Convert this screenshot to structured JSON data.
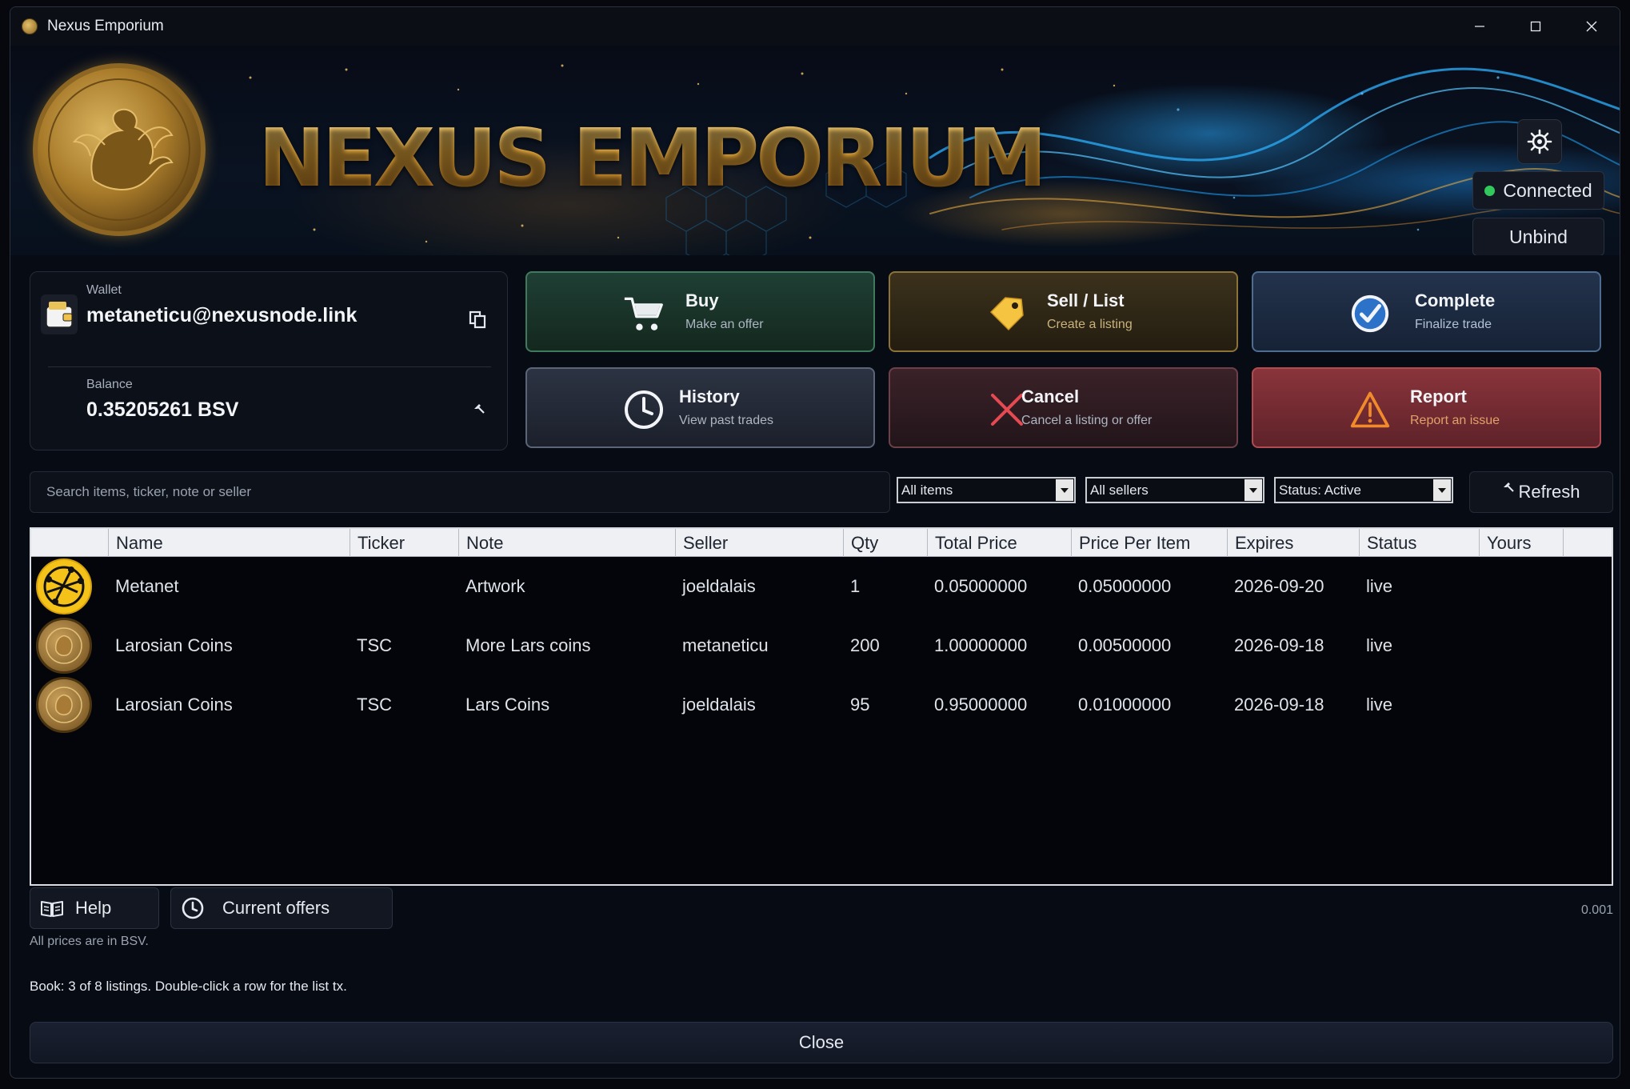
{
  "window": {
    "title": "Nexus Emporium"
  },
  "banner": {
    "title": "NEXUS EMPORIUM",
    "medallion_text": "NEXUS EMPORIUM"
  },
  "connection": {
    "status": "Connected",
    "status_color": "#31c95b",
    "unbind_label": "Unbind"
  },
  "wallet": {
    "wallet_label": "Wallet",
    "address": "metaneticu@nexusnode.link",
    "balance_label": "Balance",
    "balance": "0.35205261 BSV"
  },
  "actions": [
    {
      "title": "Buy",
      "subtitle": "Make an offer",
      "icon": "cart-icon"
    },
    {
      "title": "Sell / List",
      "subtitle": "Create a listing",
      "icon": "tag-icon"
    },
    {
      "title": "Complete",
      "subtitle": "Finalize trade",
      "icon": "check-circle-icon"
    },
    {
      "title": "History",
      "subtitle": "View past trades",
      "icon": "clock-icon"
    },
    {
      "title": "Cancel",
      "subtitle": "Cancel a listing or offer",
      "icon": "x-icon"
    },
    {
      "title": "Report",
      "subtitle": "Report an issue",
      "icon": "warning-icon"
    }
  ],
  "filters": {
    "search_placeholder": "Search items, ticker, note or seller",
    "items_selected": "All items",
    "sellers_selected": "All sellers",
    "status_selected": "Status: Active",
    "refresh_label": "Refresh"
  },
  "table": {
    "columns": [
      "Name",
      "Ticker",
      "Note",
      "Seller",
      "Qty",
      "Total Price",
      "Price Per Item",
      "Expires",
      "Status",
      "Yours"
    ],
    "rows": [
      {
        "icon": "metanet-icon",
        "name": "Metanet",
        "ticker": "",
        "note": "Artwork",
        "seller": "joeldalais",
        "qty": "1",
        "total": "0.05000000",
        "per_item": "0.05000000",
        "expires": "2026-09-20",
        "status": "live",
        "yours": ""
      },
      {
        "icon": "lion-coin-icon",
        "name": "Larosian Coins",
        "ticker": "TSC",
        "note": "More Lars coins",
        "seller": "metaneticu",
        "qty": "200",
        "total": "1.00000000",
        "per_item": "0.00500000",
        "expires": "2026-09-18",
        "status": "live",
        "yours": ""
      },
      {
        "icon": "lion-coin-icon",
        "name": "Larosian Coins",
        "ticker": "TSC",
        "note": "Lars Coins",
        "seller": "joeldalais",
        "qty": "95",
        "total": "0.95000000",
        "per_item": "0.01000000",
        "expires": "2026-09-18",
        "status": "live",
        "yours": ""
      }
    ]
  },
  "footer": {
    "help_label": "Help",
    "offers_label": "Current offers",
    "currency_note": "All prices are in BSV.",
    "fee_value": "0.001",
    "book_status": "Book: 3 of 8 listings. Double-click a row for the list tx.",
    "close_label": "Close"
  }
}
